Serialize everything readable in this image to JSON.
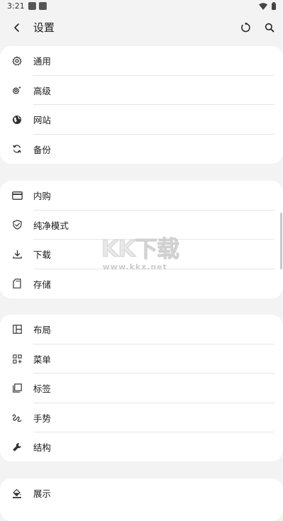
{
  "status_bar": {
    "time": "3:21"
  },
  "app_bar": {
    "title": "设置"
  },
  "sections": [
    {
      "items": [
        {
          "label": "通用",
          "icon": "gear-icon"
        },
        {
          "label": "高级",
          "icon": "advanced-settings-icon"
        },
        {
          "label": "网站",
          "icon": "globe-icon"
        },
        {
          "label": "备份",
          "icon": "sync-icon"
        }
      ]
    },
    {
      "items": [
        {
          "label": "内购",
          "icon": "credit-card-icon"
        },
        {
          "label": "纯净模式",
          "icon": "shield-icon"
        },
        {
          "label": "下载",
          "icon": "download-icon"
        },
        {
          "label": "存储",
          "icon": "sd-card-icon"
        }
      ]
    },
    {
      "items": [
        {
          "label": "布局",
          "icon": "layout-icon"
        },
        {
          "label": "菜单",
          "icon": "menu-grid-icon"
        },
        {
          "label": "标签",
          "icon": "tabs-icon"
        },
        {
          "label": "手势",
          "icon": "gesture-icon"
        },
        {
          "label": "结构",
          "icon": "wrench-icon"
        }
      ]
    },
    {
      "items": [
        {
          "label": "展示",
          "icon": "paint-bucket-icon"
        }
      ]
    }
  ],
  "watermark": {
    "text": "KK下载",
    "url": "www.kkx.net"
  }
}
